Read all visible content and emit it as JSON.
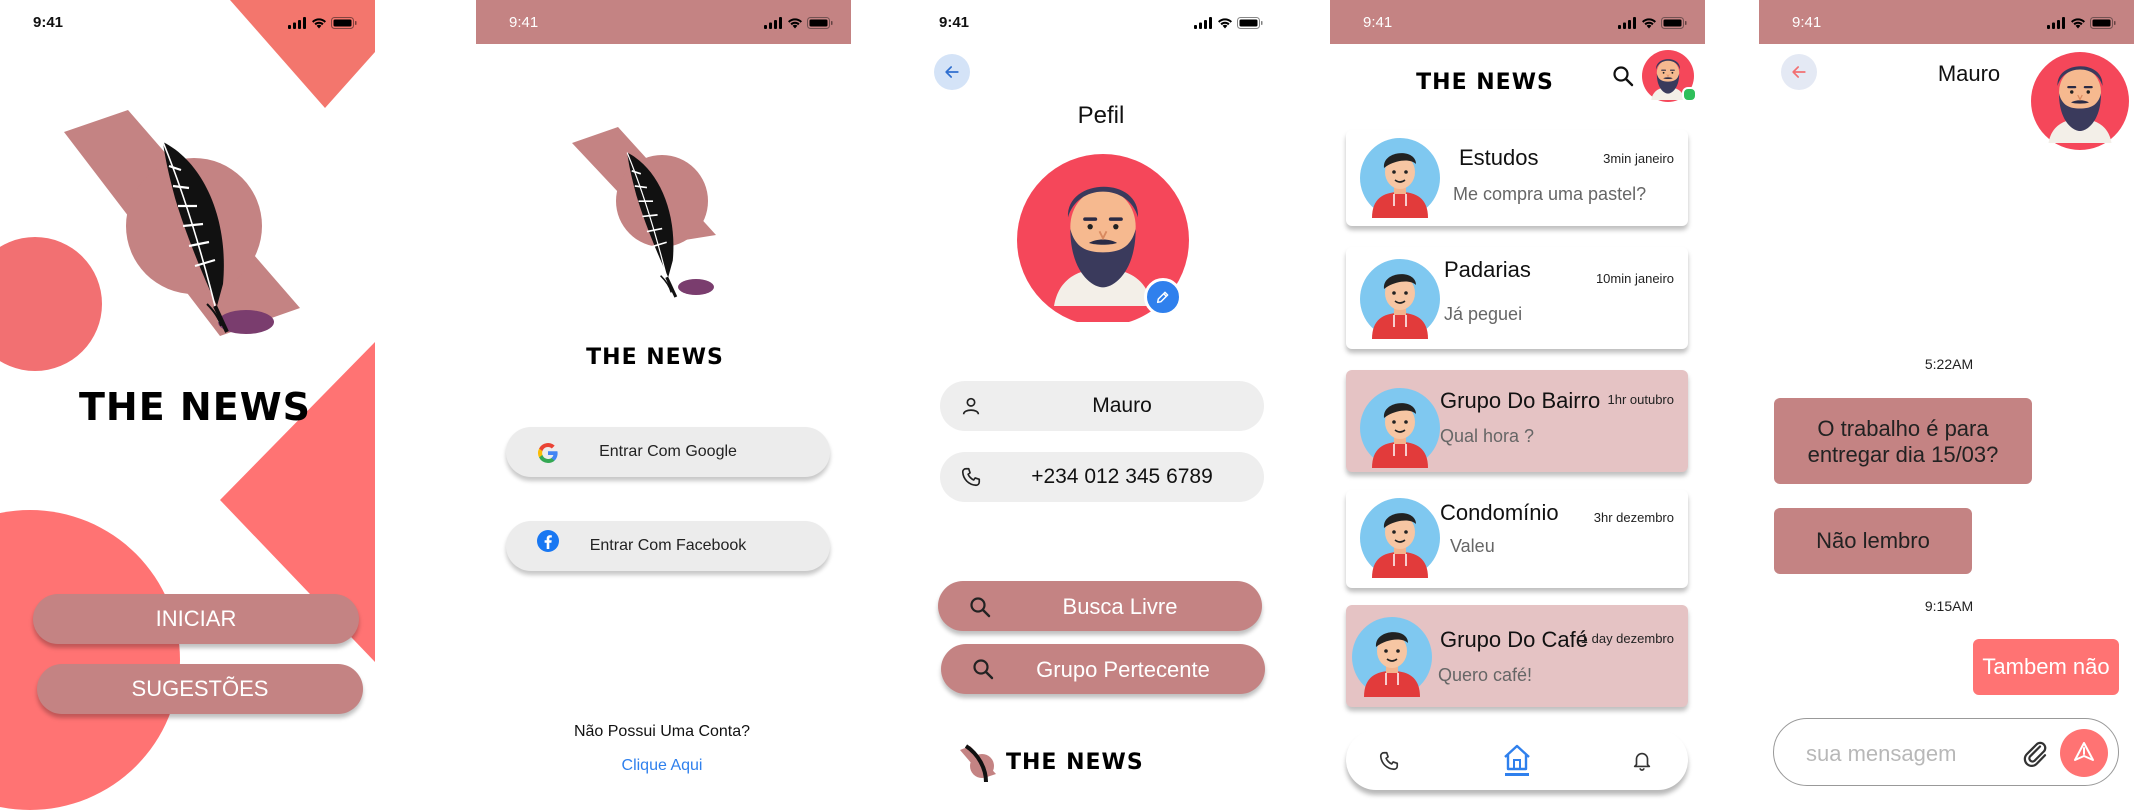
{
  "status": {
    "time": "9:41"
  },
  "splash": {
    "brand": "THE NEWS",
    "start_label": "INICIAR",
    "suggestions_label": "SUGESTÕES"
  },
  "login": {
    "brand": "THE NEWS",
    "google_label": "Entrar Com Google",
    "facebook_label": "Entrar Com Facebook",
    "no_account": "Não Possui Uma Conta?",
    "click_here": "Clique Aqui"
  },
  "profile": {
    "title": "Pefil",
    "name": "Mauro",
    "phone": "+234 012 345 6789",
    "free_search_label": "Busca Livre",
    "group_label": "Grupo Pertecente",
    "brand": "THE NEWS"
  },
  "feed": {
    "brand": "THE NEWS",
    "chats": [
      {
        "name": "Estudos",
        "time": "3min janeiro",
        "message": "Me compra uma pastel?"
      },
      {
        "name": "Padarias",
        "time": "10min janeiro",
        "message": "Já peguei"
      },
      {
        "name": "Grupo Do Bairro",
        "time": "1hr  outubro",
        "message": "Qual hora ?"
      },
      {
        "name": "Condomínio",
        "time": "3hr dezembro",
        "message": "Valeu"
      },
      {
        "name": "Grupo Do Café",
        "time": "1 day dezembro",
        "message": "Quero café!"
      }
    ]
  },
  "conversation": {
    "contact": "Mauro",
    "first_time": "5:22AM",
    "bubble1": "O trabalho é para entregar dia 15/03?",
    "bubble2": "Não lembro",
    "second_time": "9:15AM",
    "bubble3": "Tambem não",
    "input_placeholder": "sua mensagem"
  },
  "colors": {
    "brand_pink": "#c48383",
    "coral": "#ff7373",
    "highlight": "#e5c3c4",
    "link_blue": "#2f80ed"
  }
}
